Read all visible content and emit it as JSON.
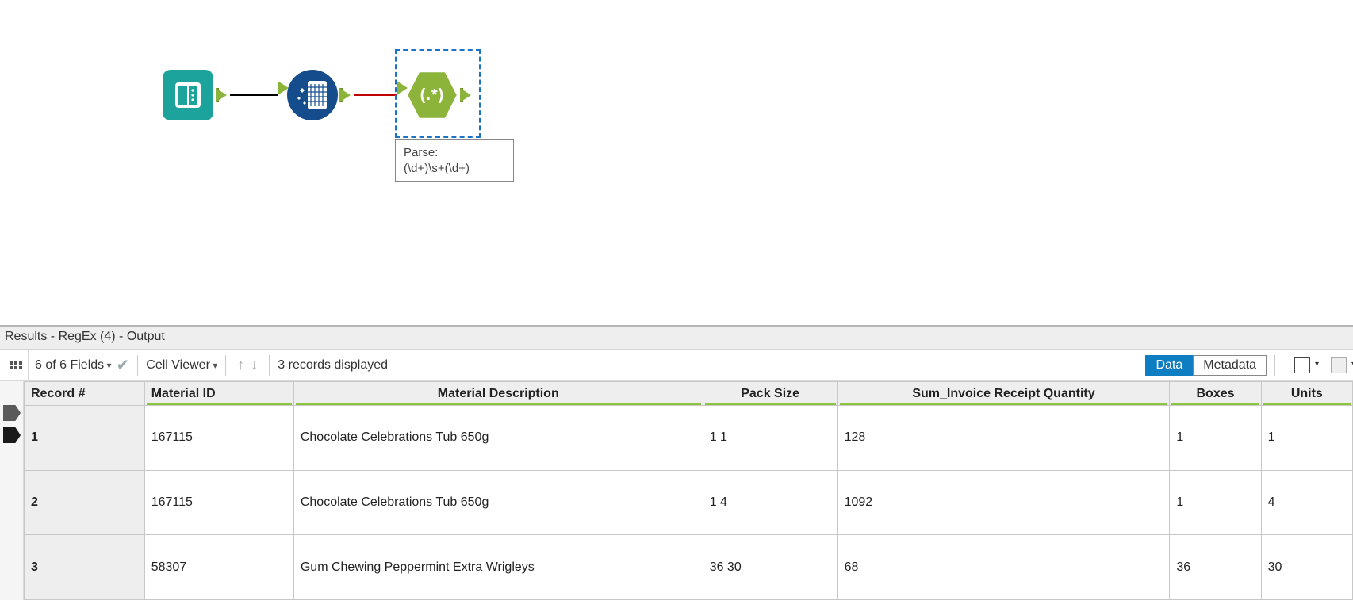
{
  "canvas": {
    "annotation": {
      "line1": "Parse:",
      "line2": "(\\d+)\\s+(\\d+)"
    },
    "regex_label": "(.*)"
  },
  "results": {
    "title": "Results - RegEx (4) - Output",
    "fields_label": "6 of 6 Fields",
    "cell_viewer_label": "Cell Viewer",
    "records_label": "3 records displayed",
    "tab_data": "Data",
    "tab_metadata": "Metadata",
    "columns": [
      "Record #",
      "Material ID",
      "Material Description",
      "Pack Size",
      "Sum_Invoice Receipt Quantity",
      "Boxes",
      "Units"
    ],
    "rows": [
      {
        "n": "1",
        "mid": "167115",
        "desc": "Chocolate Celebrations Tub 650g",
        "pack": "1  1",
        "sum": "128",
        "boxes": "1",
        "units": "1"
      },
      {
        "n": "2",
        "mid": "167115",
        "desc": "Chocolate Celebrations Tub 650g",
        "pack": "1  4",
        "sum": "1092",
        "boxes": "1",
        "units": "4"
      },
      {
        "n": "3",
        "mid": "58307",
        "desc": "Gum Chewing Peppermint Extra Wrigleys",
        "pack": "36   30",
        "sum": "68",
        "boxes": "36",
        "units": "30"
      }
    ]
  }
}
